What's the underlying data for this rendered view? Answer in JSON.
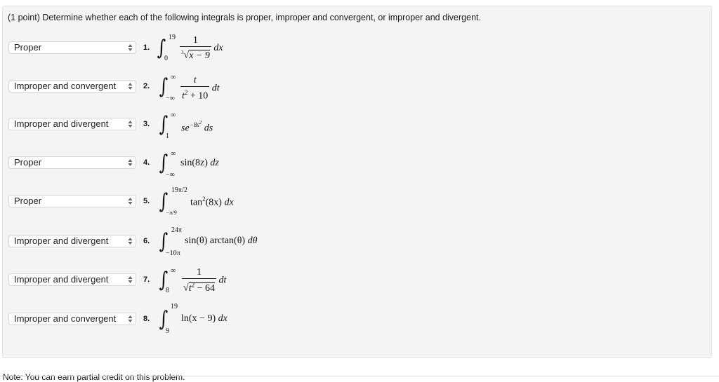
{
  "question": {
    "intro": "(1 point) Determine whether each of the following integrals is proper, improper and convergent, or improper and divergent.",
    "options_icon": "up-down-arrows-icon",
    "items": [
      {
        "number": "1.",
        "selected": "Proper",
        "upper": "19",
        "lower": "0",
        "numerator": "1",
        "root_index": "3",
        "denominator": "x − 9",
        "differential": "dx"
      },
      {
        "number": "2.",
        "selected": "Improper and convergent",
        "upper": "∞",
        "lower": "−∞",
        "numerator": "t",
        "denominator_base": "t",
        "denominator_exp": "2",
        "denominator_rest": " + 10",
        "differential": "dt"
      },
      {
        "number": "3.",
        "selected": "Improper and divergent",
        "upper": "∞",
        "lower": "1",
        "integrand_base": "se",
        "exponent": "−8s",
        "exponent_power": "2",
        "differential": "ds"
      },
      {
        "number": "4.",
        "selected": "Proper",
        "upper": "∞",
        "lower": "−∞",
        "integrand": "sin(8z)",
        "differential": "dz"
      },
      {
        "number": "5.",
        "selected": "Proper",
        "upper": "19π/2",
        "lower": "−π/9",
        "integrand_fn": "tan",
        "integrand_power": "2",
        "integrand_arg": "(8x)",
        "differential": "dx"
      },
      {
        "number": "6.",
        "selected": "Improper and divergent",
        "upper": "24π",
        "lower": "−10π",
        "integrand": "sin(θ) arctan(θ)",
        "differential": "dθ"
      },
      {
        "number": "7.",
        "selected": "Improper and divergent",
        "upper": "∞",
        "lower": "8",
        "numerator": "1",
        "radicand_base": "t",
        "radicand_exp": "2",
        "radicand_rest": " − 64",
        "differential": "dt"
      },
      {
        "number": "8.",
        "selected": "Improper and convergent",
        "upper": "19",
        "lower": "9",
        "integrand": "ln(x − 9)",
        "differential": "dx"
      }
    ]
  },
  "footer": {
    "note": "Note: You can earn partial credit on this problem."
  }
}
